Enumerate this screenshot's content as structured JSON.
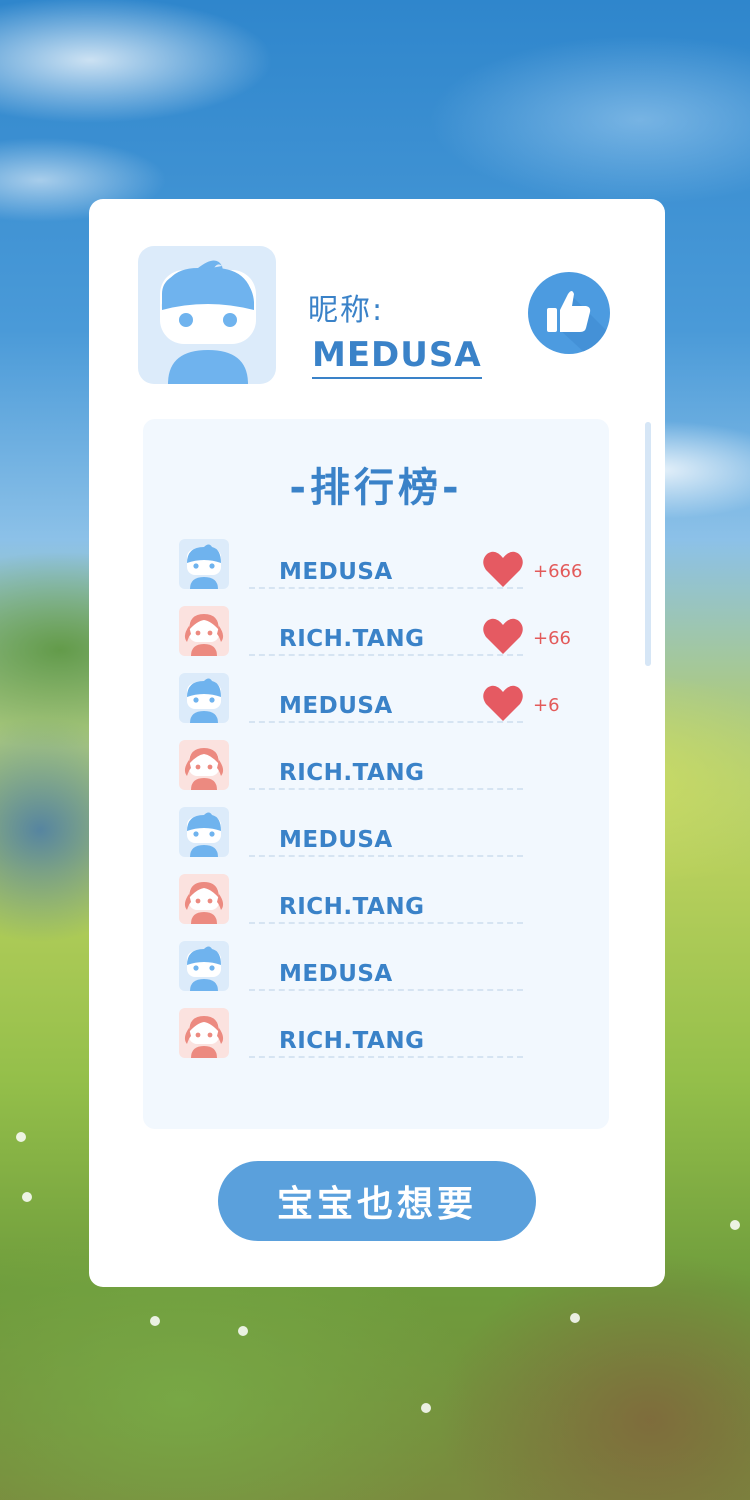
{
  "profile": {
    "nickname_label": "昵称:",
    "nickname": "MEDUSA",
    "avatar_icon": "boy-avatar-icon",
    "like_icon": "thumbs-up-icon"
  },
  "leaderboard": {
    "title": "-排行榜-",
    "rows": [
      {
        "name": "MEDUSA",
        "avatar": "boy",
        "score": "+666"
      },
      {
        "name": "RICH.TANG",
        "avatar": "girl",
        "score": "+66"
      },
      {
        "name": "MEDUSA",
        "avatar": "boy",
        "score": "+6"
      },
      {
        "name": "RICH.TANG",
        "avatar": "girl",
        "score": ""
      },
      {
        "name": "MEDUSA",
        "avatar": "boy",
        "score": ""
      },
      {
        "name": "RICH.TANG",
        "avatar": "girl",
        "score": ""
      },
      {
        "name": "MEDUSA",
        "avatar": "boy",
        "score": ""
      },
      {
        "name": "RICH.TANG",
        "avatar": "girl",
        "score": ""
      }
    ]
  },
  "cta": {
    "label": "宝宝也想要"
  },
  "colors": {
    "accent": "#3a82c8",
    "button": "#5aa0dc",
    "heart": "#e55a62",
    "girl": "#ec8a80",
    "boy": "#6fb3ee"
  }
}
